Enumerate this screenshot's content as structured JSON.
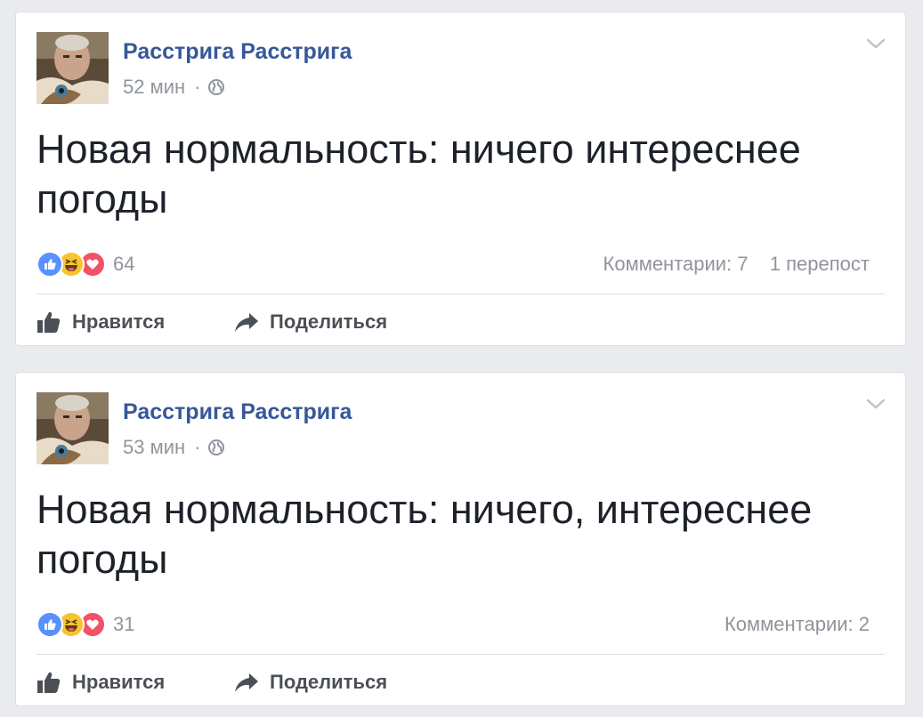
{
  "colors": {
    "author": "#365899",
    "meta": "#90949c",
    "message": "#1d2129",
    "background": "#e9ebee",
    "like_reaction": "#5890ff",
    "haha_reaction": "#f7c431",
    "love_reaction": "#f25268"
  },
  "posts": [
    {
      "author": "Расстрига Расстрига",
      "time": "52 мин",
      "separator": "·",
      "privacy_icon": "globe-icon",
      "message": "Новая нормальность: ничего интереснее погоды",
      "reactions": {
        "icons": [
          "like",
          "haha",
          "love"
        ],
        "count": "64"
      },
      "comments": "Комментарии: 7",
      "shares": "1 перепост",
      "actions": {
        "like": "Нравится",
        "share": "Поделиться"
      }
    },
    {
      "author": "Расстрига Расстрига",
      "time": "53 мин",
      "separator": "·",
      "privacy_icon": "globe-icon",
      "message": "Новая нормальность: ничего, интереснее погоды",
      "reactions": {
        "icons": [
          "like",
          "haha",
          "love"
        ],
        "count": "31"
      },
      "comments": "Комментарии: 2",
      "shares": "",
      "actions": {
        "like": "Нравится",
        "share": "Поделиться"
      }
    }
  ]
}
